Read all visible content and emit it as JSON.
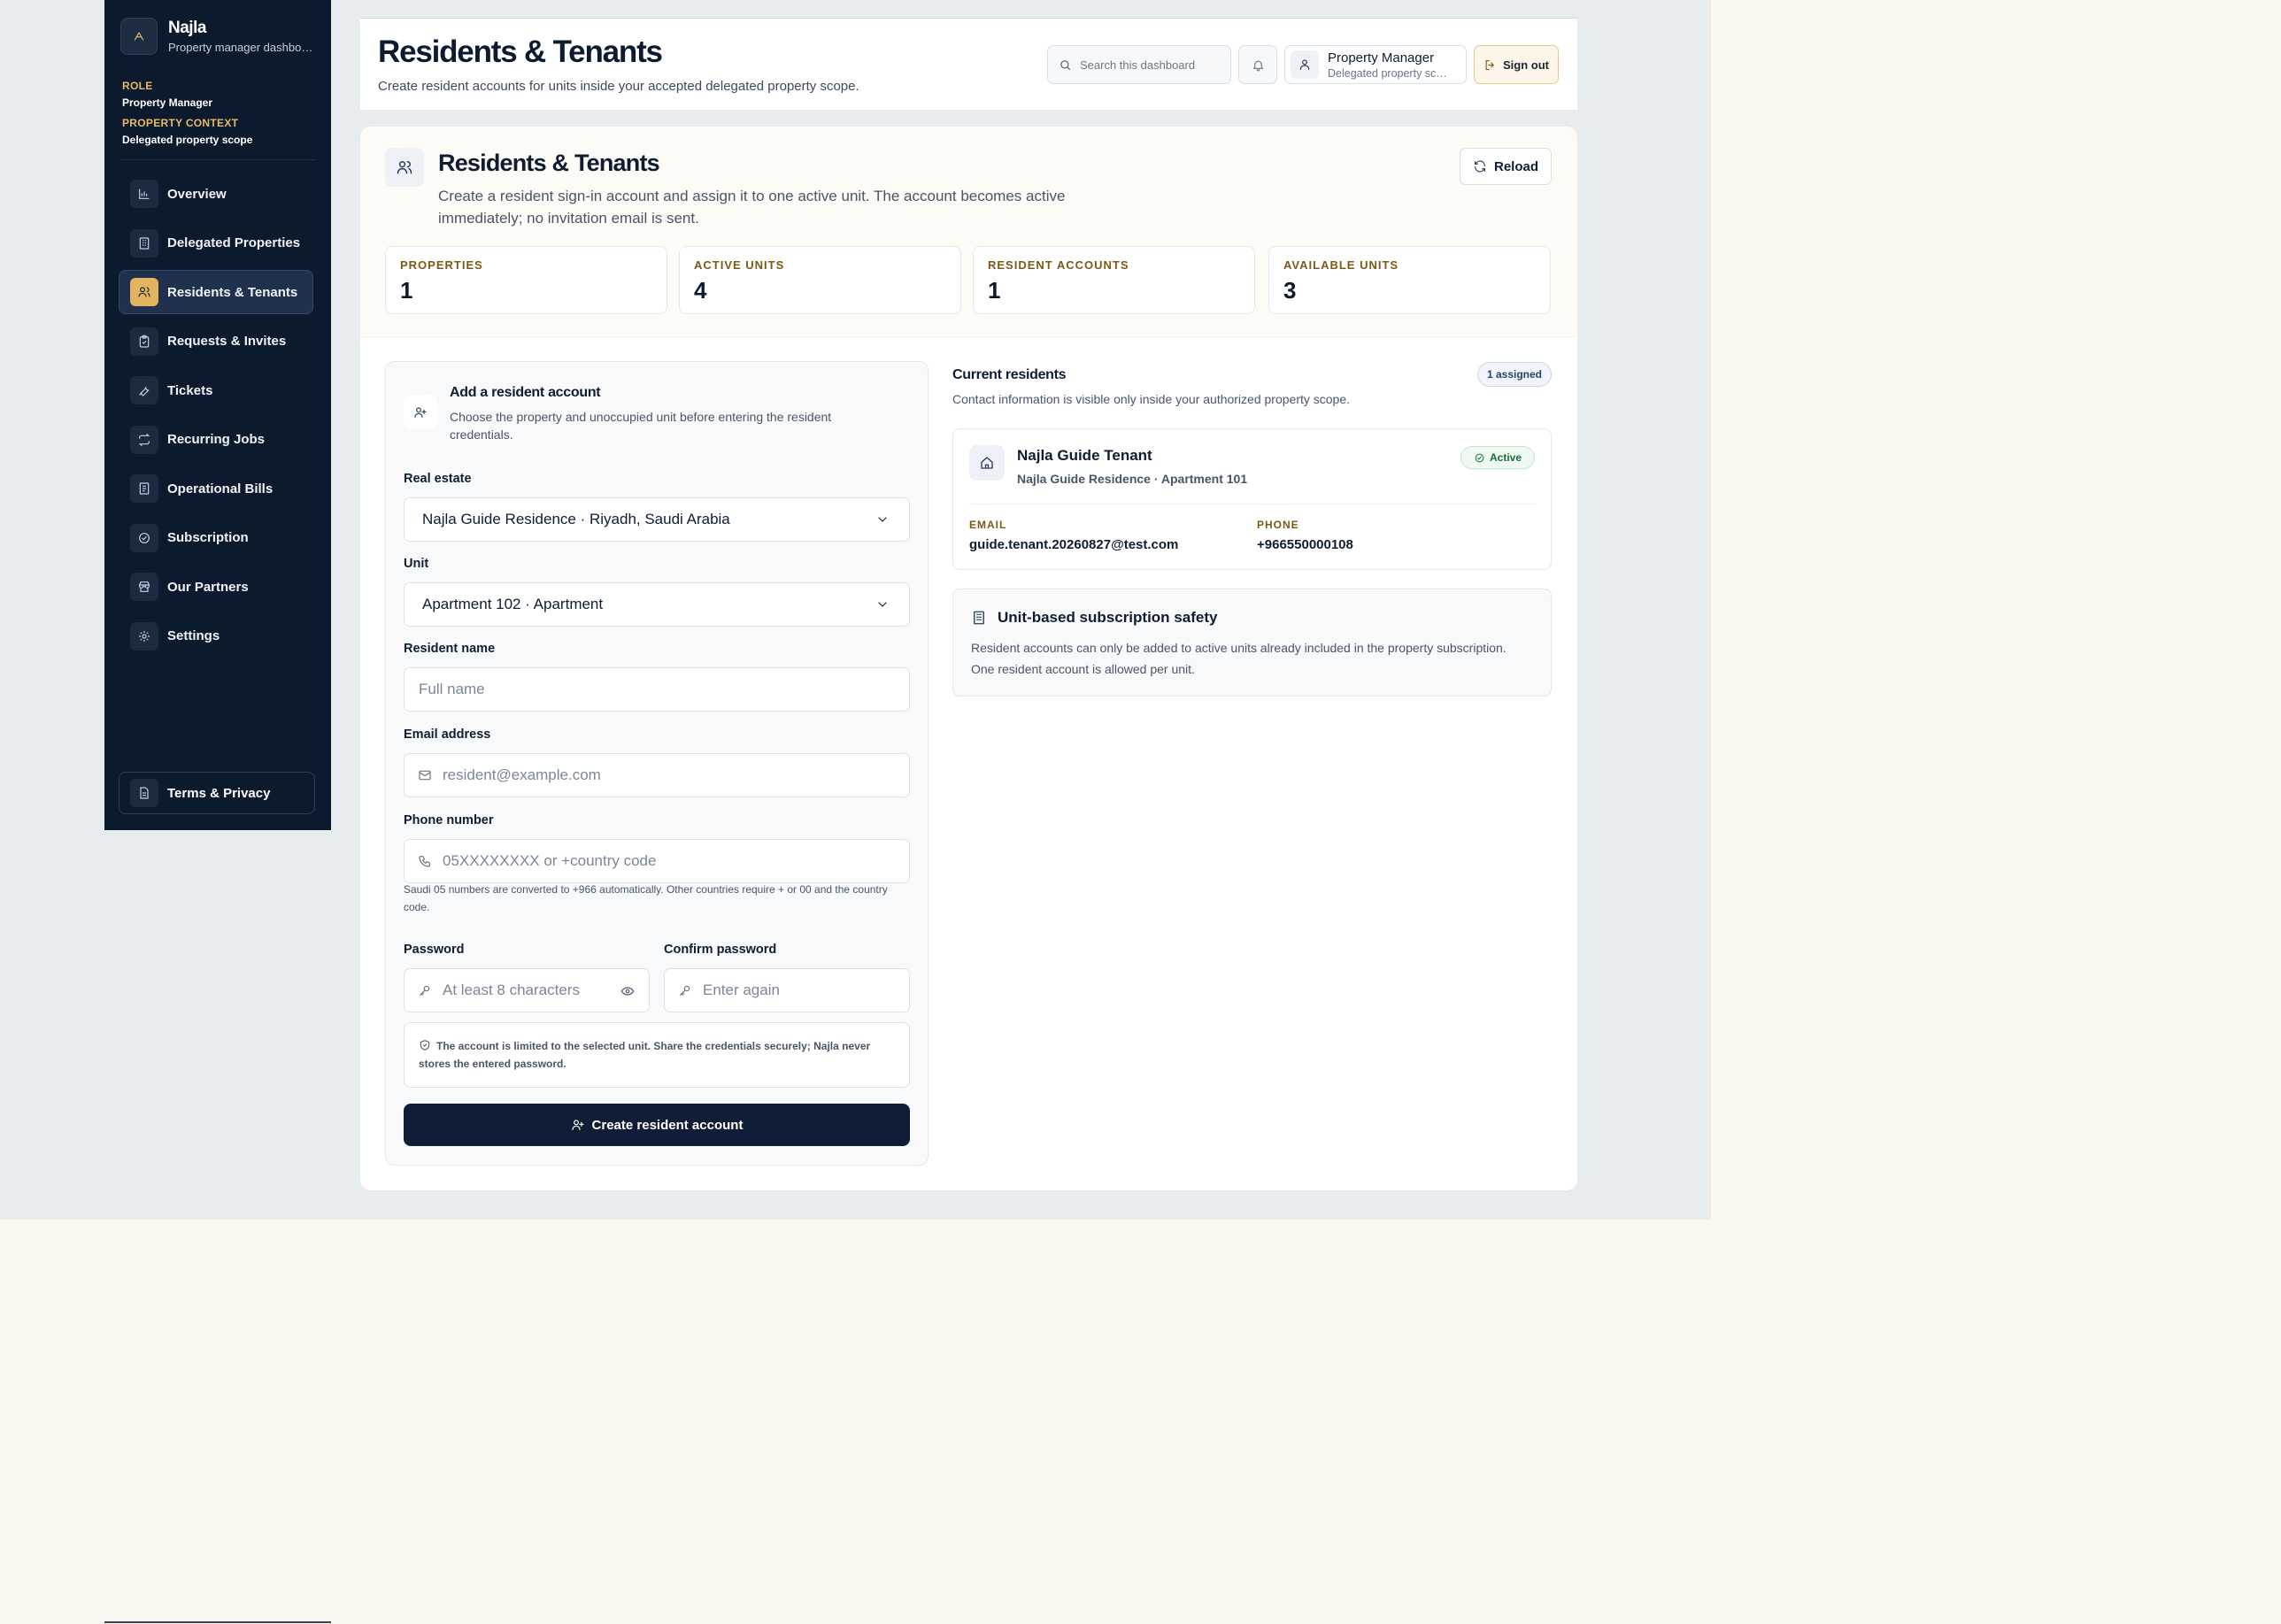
{
  "sidebar": {
    "brand_name": "Najla",
    "brand_sub": "Property manager dashboard",
    "role_label": "ROLE",
    "role_value": "Property Manager",
    "context_label": "PROPERTY CONTEXT",
    "context_value": "Delegated property scope",
    "items": [
      {
        "label": "Overview",
        "icon": "chart-icon"
      },
      {
        "label": "Delegated Properties",
        "icon": "building-icon"
      },
      {
        "label": "Residents & Tenants",
        "icon": "users-icon",
        "active": true
      },
      {
        "label": "Requests & Invites",
        "icon": "clipboard-icon"
      },
      {
        "label": "Tickets",
        "icon": "wrench-icon"
      },
      {
        "label": "Recurring Jobs",
        "icon": "repeat-icon"
      },
      {
        "label": "Operational Bills",
        "icon": "receipt-icon"
      },
      {
        "label": "Subscription",
        "icon": "check-circle-icon"
      },
      {
        "label": "Our Partners",
        "icon": "store-icon"
      },
      {
        "label": "Settings",
        "icon": "gear-icon"
      }
    ],
    "terms_label": "Terms & Privacy"
  },
  "header": {
    "title": "Residents & Tenants",
    "subtitle": "Create resident accounts for units inside your accepted delegated property scope.",
    "search_placeholder": "Search this dashboard",
    "user_name": "Property Manager",
    "user_role": "Delegated property scope",
    "signout_label": "Sign out"
  },
  "section": {
    "title": "Residents & Tenants",
    "description": "Create a resident sign-in account and assign it to one active unit. The account becomes active immediately; no invitation email is sent.",
    "reload_label": "Reload",
    "stats": [
      {
        "label": "PROPERTIES",
        "value": "1"
      },
      {
        "label": "ACTIVE UNITS",
        "value": "4"
      },
      {
        "label": "RESIDENT ACCOUNTS",
        "value": "1"
      },
      {
        "label": "AVAILABLE UNITS",
        "value": "3"
      }
    ]
  },
  "form": {
    "title": "Add a resident account",
    "description": "Choose the property and unoccupied unit before entering the resident credentials.",
    "real_estate_label": "Real estate",
    "real_estate_value": "Najla Guide Residence · Riyadh, Saudi Arabia",
    "unit_label": "Unit",
    "unit_value": "Apartment 102 · Apartment",
    "name_label": "Resident name",
    "name_placeholder": "Full name",
    "email_label": "Email address",
    "email_placeholder": "resident@example.com",
    "phone_label": "Phone number",
    "phone_placeholder": "05XXXXXXXX or +country code",
    "phone_hint": "Saudi 05 numbers are converted to +966 automatically. Other countries require + or 00 and the country code.",
    "password_label": "Password",
    "password_placeholder": "At least 8 characters",
    "confirm_label": "Confirm password",
    "confirm_placeholder": "Enter again",
    "notice": "The account is limited to the selected unit. Share the credentials securely; Najla never stores the entered password.",
    "submit_label": "Create resident account"
  },
  "residents": {
    "title": "Current residents",
    "subtitle": "Contact information is visible only inside your authorized property scope.",
    "badge": "1 assigned",
    "list": [
      {
        "name": "Najla Guide Tenant",
        "unit": "Najla Guide Residence · Apartment 101",
        "status": "Active",
        "email_label": "EMAIL",
        "email": "guide.tenant.20260827@test.com",
        "phone_label": "PHONE",
        "phone": "+966550000108"
      }
    ],
    "safety_title": "Unit-based subscription safety",
    "safety_desc": "Resident accounts can only be added to active units already included in the property subscription. One resident account is allowed per unit."
  }
}
